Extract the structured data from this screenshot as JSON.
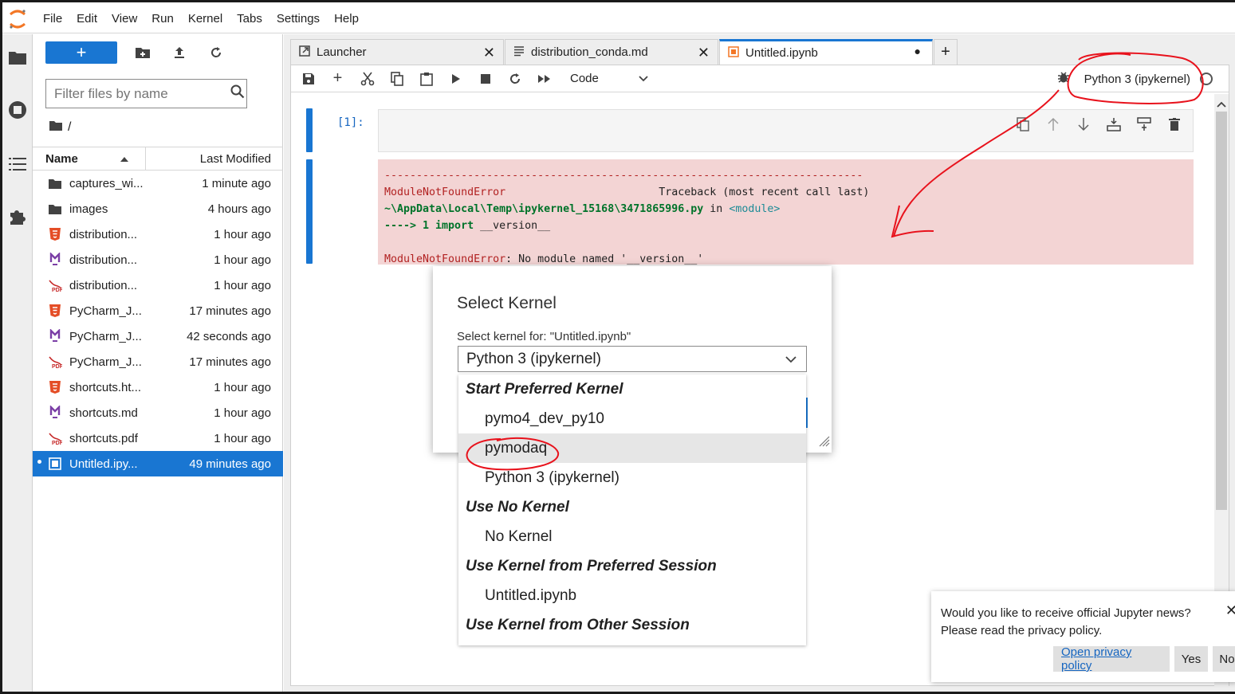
{
  "menu": [
    "File",
    "Edit",
    "View",
    "Run",
    "Kernel",
    "Tabs",
    "Settings",
    "Help"
  ],
  "filebrowser": {
    "new_label": "+",
    "filter_placeholder": "Filter files by name",
    "breadcrumb": "/",
    "col_name": "Name",
    "col_modified": "Last Modified",
    "files": [
      {
        "name": "captures_wi...",
        "modified": "1 minute ago",
        "icon": "folder-icon"
      },
      {
        "name": "images",
        "modified": "4 hours ago",
        "icon": "folder-icon"
      },
      {
        "name": "distribution...",
        "modified": "1 hour ago",
        "icon": "html-file-icon"
      },
      {
        "name": "distribution...",
        "modified": "1 hour ago",
        "icon": "markdown-file-icon"
      },
      {
        "name": "distribution...",
        "modified": "1 hour ago",
        "icon": "pdf-file-icon"
      },
      {
        "name": "PyCharm_J...",
        "modified": "17 minutes ago",
        "icon": "html-file-icon"
      },
      {
        "name": "PyCharm_J...",
        "modified": "42 seconds ago",
        "icon": "markdown-file-icon"
      },
      {
        "name": "PyCharm_J...",
        "modified": "17 minutes ago",
        "icon": "pdf-file-icon"
      },
      {
        "name": "shortcuts.ht...",
        "modified": "1 hour ago",
        "icon": "html-file-icon"
      },
      {
        "name": "shortcuts.md",
        "modified": "1 hour ago",
        "icon": "markdown-file-icon"
      },
      {
        "name": "shortcuts.pdf",
        "modified": "1 hour ago",
        "icon": "pdf-file-icon"
      },
      {
        "name": "Untitled.ipy...",
        "modified": "49 minutes ago",
        "icon": "notebook-file-icon",
        "selected": true
      }
    ]
  },
  "tabs": [
    {
      "label": "Launcher"
    },
    {
      "label": "distribution_conda.md"
    },
    {
      "label": "Untitled.ipynb"
    }
  ],
  "toolbar": {
    "cell_type": "Code",
    "kernel_name": "Python 3 (ipykernel)"
  },
  "cell": {
    "prompt": "[1]:"
  },
  "output": {
    "dashes": "---------------------------------------------------------------------------",
    "error_name": "ModuleNotFoundError",
    "traceback_label": "Traceback (most recent call last)",
    "path": "~\\AppData\\Local\\Temp\\ipykernel_15168\\3471865996.py",
    "in_word": " in ",
    "module": "<module>",
    "arrow_line": "----> 1 import",
    "arrow_rest": " __version__",
    "error_msg": ": No module named '__version__'"
  },
  "dialog": {
    "title": "Select Kernel",
    "label": "Select kernel for: \"Untitled.ipynb\"",
    "selected": "Python 3 (ipykernel)",
    "options": [
      {
        "label": "Start Preferred Kernel",
        "group": true
      },
      {
        "label": "pymo4_dev_py10"
      },
      {
        "label": "pymodaq",
        "hover": true
      },
      {
        "label": "Python 3 (ipykernel)"
      },
      {
        "label": "Use No Kernel",
        "group": true
      },
      {
        "label": "No Kernel"
      },
      {
        "label": "Use Kernel from Preferred Session",
        "group": true
      },
      {
        "label": "Untitled.ipynb"
      },
      {
        "label": "Use Kernel from Other Session",
        "group": true
      }
    ]
  },
  "notification": {
    "line1": "Would you like to receive official Jupyter news?",
    "line2": "Please read the privacy policy.",
    "privacy_link": "Open privacy policy",
    "yes": "Yes",
    "no": "No"
  },
  "colors": {
    "accent": "#1976d2",
    "error_bg": "#f3d4d4",
    "annotation": "#e8121c"
  }
}
